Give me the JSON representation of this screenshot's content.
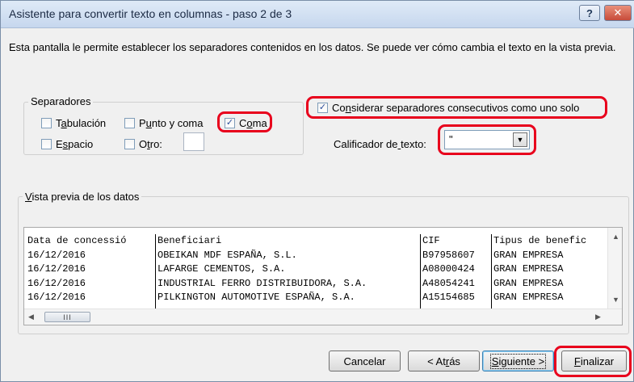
{
  "window": {
    "title": "Asistente para convertir texto en columnas - paso 2 de 3",
    "help_glyph": "?",
    "close_glyph": "✕"
  },
  "description": "Esta pantalla le permite establecer los separadores contenidos en los datos. Se puede ver cómo cambia el texto en la vista previa.",
  "separators": {
    "legend": "Separadores",
    "tab": {
      "label": "Tabulación",
      "checked": false
    },
    "semicolon": {
      "label": "Punto y coma",
      "checked": false
    },
    "comma": {
      "label": "Coma",
      "checked": true
    },
    "space": {
      "label": "Espacio",
      "checked": false
    },
    "other": {
      "label": "Otro:",
      "checked": false,
      "value": ""
    }
  },
  "consecutive": {
    "label": "Considerar separadores consecutivos como uno solo",
    "checked": true
  },
  "qualifier": {
    "label": "Calificador de texto:",
    "value": "\""
  },
  "preview": {
    "legend": "Vista previa de los datos",
    "columns": [
      {
        "header": "Data de concessió",
        "rows": [
          "16/12/2016",
          "16/12/2016",
          "16/12/2016",
          "16/12/2016"
        ]
      },
      {
        "header": "Beneficiari",
        "rows": [
          "OBEIKAN MDF ESPAÑA, S.L.",
          "LAFARGE CEMENTOS, S.A.",
          "INDUSTRIAL FERRO DISTRIBUIDORA, S.A.",
          "PILKINGTON AUTOMOTIVE ESPAÑA, S.A."
        ]
      },
      {
        "header": "CIF",
        "rows": [
          "B97958607",
          "A08000424",
          "A48054241",
          "A15154685"
        ]
      },
      {
        "header": "Tipus de benefic",
        "rows": [
          "GRAN EMPRESA",
          "GRAN EMPRESA",
          "GRAN EMPRESA",
          "GRAN EMPRESA"
        ]
      }
    ],
    "thumb_glyph": "III"
  },
  "buttons": {
    "cancel": "Cancelar",
    "back": "< Atrás",
    "next": "Siguiente >",
    "finish": "Finalizar"
  },
  "highlight_color": "#e8001c"
}
